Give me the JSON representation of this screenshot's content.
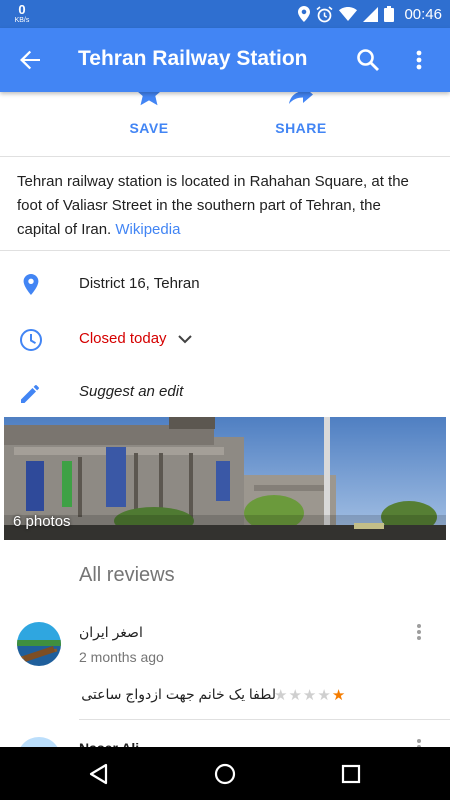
{
  "status_bar": {
    "speed_value": "0",
    "speed_unit": "KB/s",
    "time": "00:46",
    "icons": [
      "location-icon",
      "alarm-icon",
      "wifi-icon",
      "signal-icon",
      "battery-icon"
    ]
  },
  "app_bar": {
    "title": "Tehran Railway Station",
    "back_icon": "back-arrow-icon",
    "search_icon": "search-icon",
    "more_icon": "more-vert-icon"
  },
  "actions": [
    {
      "label": "SAVE",
      "icon": "star-icon"
    },
    {
      "label": "SHARE",
      "icon": "share-icon"
    }
  ],
  "description": {
    "text": "Tehran railway station is located in Rahahan Square, at the foot of Valiasr Street in the southern part of Tehran, the capital of Iran.",
    "link": "Wikipedia"
  },
  "info": {
    "address": "District 16, Tehran",
    "hours": "Closed today",
    "suggest_edit": "Suggest an edit"
  },
  "photos": {
    "count_label": "6 photos"
  },
  "reviews": {
    "title": "All reviews",
    "items": [
      {
        "name": "اصغر ایران",
        "time": "2 months ago",
        "text": "لطفا یک خانم جهت ازدواج ساعتی",
        "rating": 1,
        "max_rating": 5
      },
      {
        "name": "Naser Ali"
      }
    ]
  },
  "colors": {
    "status_bar": "#2f6fd0",
    "app_bar": "#4285f4",
    "accent": "#4285f4",
    "closed": "#d50000",
    "star": "#f57c00"
  }
}
